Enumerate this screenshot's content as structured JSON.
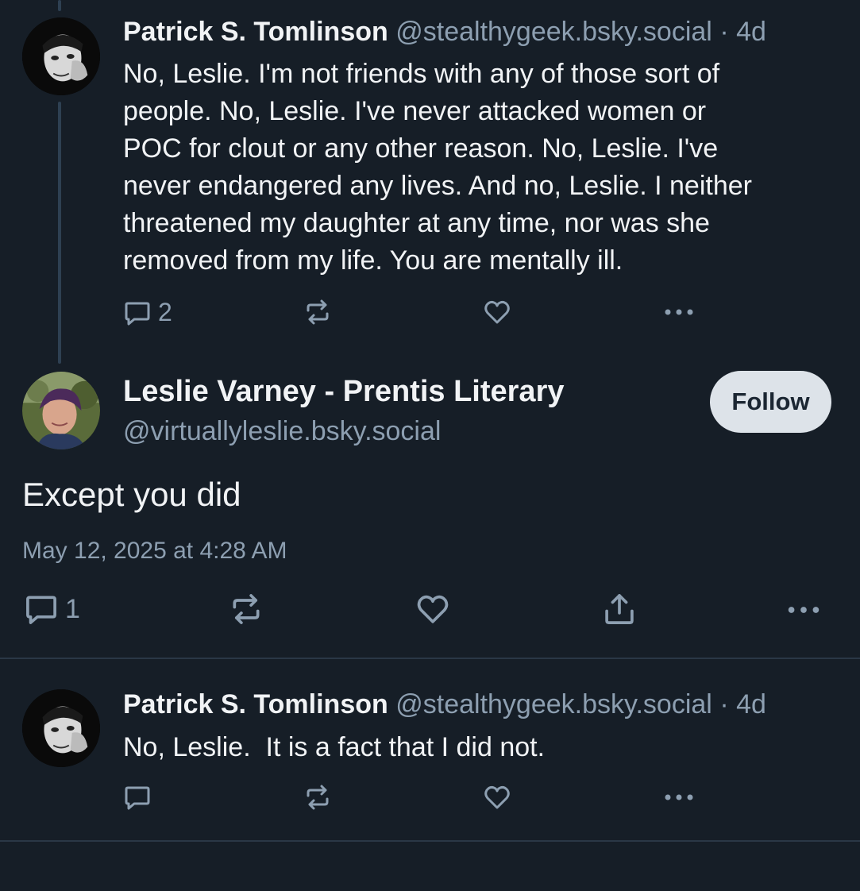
{
  "posts": {
    "parent": {
      "author_name": "Patrick S. Tomlinson",
      "author_handle": "@stealthygeek.bsky.social",
      "separator": "·",
      "time_ago": "4d",
      "text": "No, Leslie. I'm not friends with any of those sort of\npeople. No, Leslie. I've never attacked women or\nPOC for clout or any other reason. No, Leslie. I've\nnever endangered any lives. And no, Leslie. I neither\nthreatened my daughter at any time, nor was she\nremoved from my life. You are mentally ill.",
      "reply_count": "2"
    },
    "main": {
      "author_name": "Leslie Varney - Prentis Literary",
      "author_handle": "@virtuallyleslie.bsky.social",
      "follow_label": "Follow",
      "text": "Except you did",
      "timestamp": "May 12, 2025 at 4:28 AM",
      "reply_count": "1"
    },
    "reply": {
      "author_name": "Patrick S. Tomlinson",
      "author_handle": "@stealthygeek.bsky.social",
      "separator": "·",
      "time_ago": "4d",
      "text": "No, Leslie.  It is a fact that I did not."
    }
  },
  "icons": {
    "reply": "reply-icon",
    "repost": "repost-icon",
    "like": "heart-icon",
    "share": "share-icon",
    "more": "more-icon"
  },
  "colors": {
    "background": "#161e27",
    "text": "#f1f3f5",
    "muted": "#8d9fb1",
    "thread_line": "#2e4052",
    "follow_bg": "#dde3e9"
  }
}
